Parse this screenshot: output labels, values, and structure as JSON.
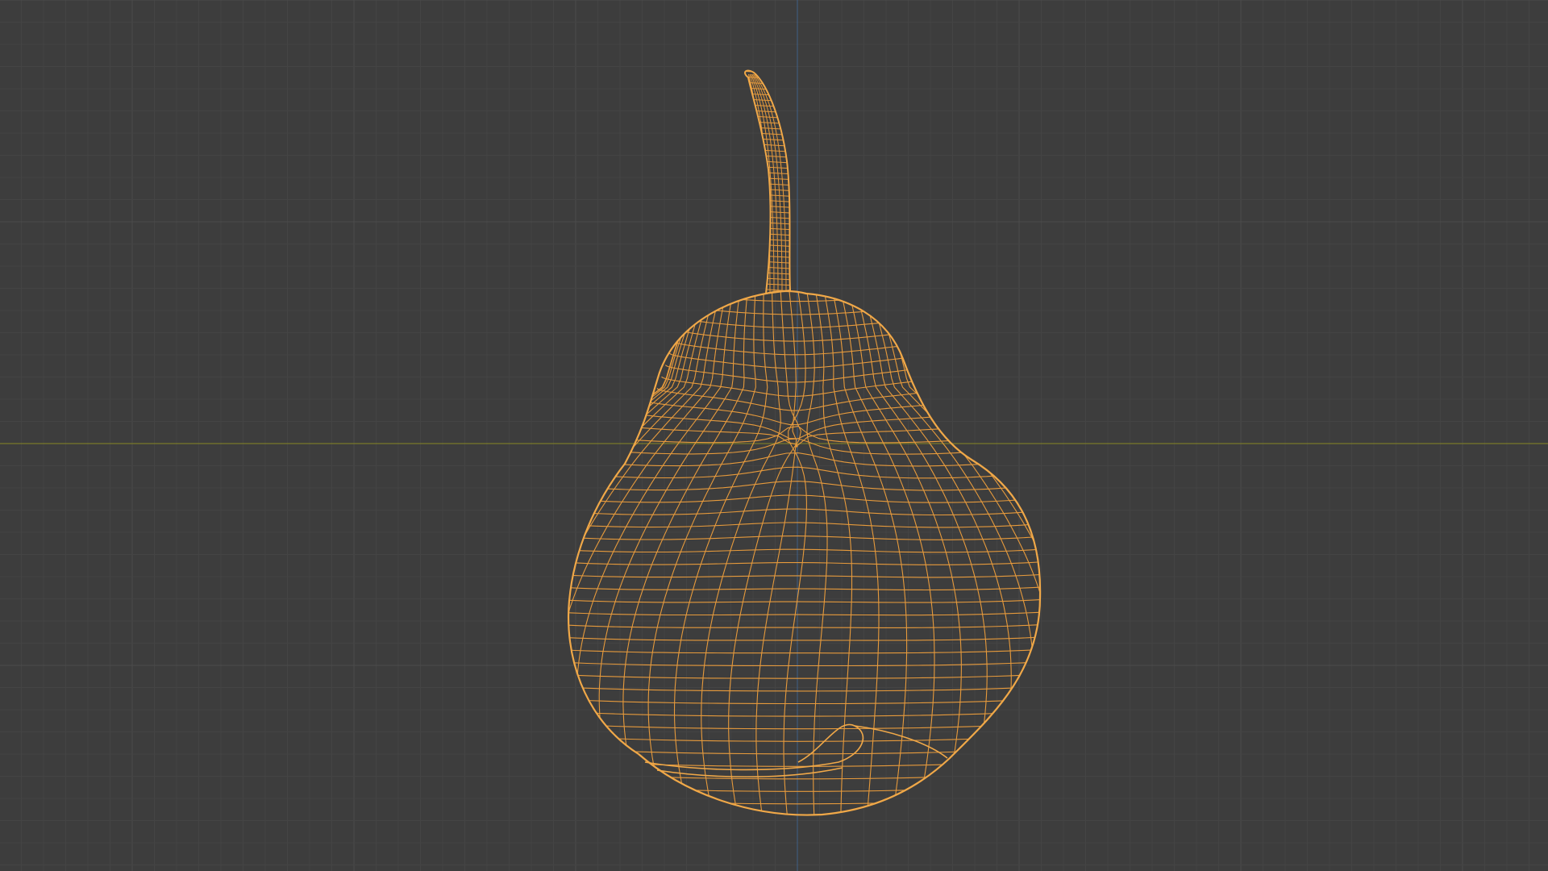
{
  "viewport": {
    "mode": "wireframe",
    "object": "pear"
  },
  "colors": {
    "background": "#3d3d3d",
    "grid_minor": "#444444",
    "grid_major": "#4b4b4b",
    "axis_x": "#7a7a2a",
    "axis_z": "#3f5f86",
    "wire": "#e69a3c",
    "wire_outline": "#f0a848"
  },
  "icons": {
    "origin": "origin-dot-icon"
  }
}
